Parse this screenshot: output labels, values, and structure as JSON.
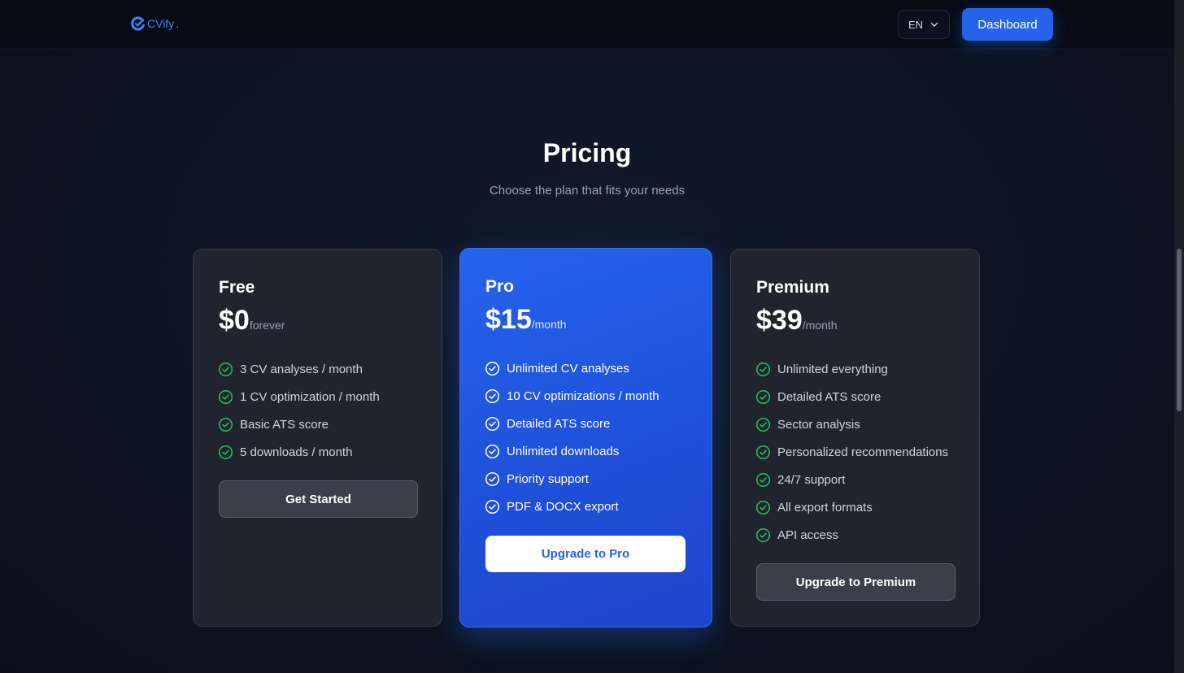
{
  "header": {
    "logo_text": "CVify",
    "logo_dot": ".",
    "lang_label": "EN",
    "dashboard_label": "Dashboard"
  },
  "hero": {
    "title": "Pricing",
    "subtitle": "Choose the plan that fits your needs"
  },
  "plans": [
    {
      "name": "Free",
      "price": "$0",
      "period": "forever",
      "features": [
        "3 CV analyses / month",
        "1 CV optimization / month",
        "Basic ATS score",
        "5 downloads / month"
      ],
      "cta": "Get Started"
    },
    {
      "name": "Pro",
      "price": "$15",
      "period": "/month",
      "features": [
        "Unlimited CV analyses",
        "10 CV optimizations / month",
        "Detailed ATS score",
        "Unlimited downloads",
        "Priority support",
        "PDF & DOCX export"
      ],
      "cta": "Upgrade to Pro"
    },
    {
      "name": "Premium",
      "price": "$39",
      "period": "/month",
      "features": [
        "Unlimited everything",
        "Detailed ATS score",
        "Sector analysis",
        "Personalized recommendations",
        "24/7 support",
        "All export formats",
        "API access"
      ],
      "cta": "Upgrade to Premium"
    }
  ],
  "colors": {
    "accent": "#2563eb",
    "check_green": "#22c55e",
    "background": "#0d1422",
    "card": "#1f242e"
  },
  "icons": {
    "logo": "cvify-logo-icon",
    "lang_chevron": "chevron-down-icon",
    "feature": "check-circle-icon"
  }
}
